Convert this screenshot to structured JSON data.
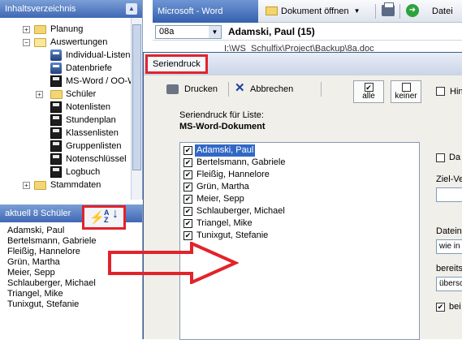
{
  "tree_panel": {
    "title": "Inhaltsverzeichnis",
    "items": [
      {
        "label": "Planung",
        "icon": "folder-icon",
        "expander": "+"
      },
      {
        "label": "Auswertungen",
        "icon": "folder-open-icon",
        "expander": "-"
      },
      {
        "label": "Individual-Listen",
        "icon": "printer-icon"
      },
      {
        "label": "Datenbriefe",
        "icon": "printer-icon"
      },
      {
        "label": "MS-Word / OO-W",
        "icon": "disk-icon"
      },
      {
        "label": "Schüler",
        "icon": "folder-icon",
        "expander": "+"
      },
      {
        "label": "Notenlisten",
        "icon": "disk-icon"
      },
      {
        "label": "Stundenplan",
        "icon": "disk-icon"
      },
      {
        "label": "Klassenlisten",
        "icon": "disk-icon"
      },
      {
        "label": "Gruppenlisten",
        "icon": "disk-icon"
      },
      {
        "label": "Notenschlüssel",
        "icon": "disk-icon"
      },
      {
        "label": "Logbuch",
        "icon": "disk-icon"
      },
      {
        "label": "Stammdaten",
        "icon": "folder-icon",
        "expander": "+"
      }
    ]
  },
  "student_panel": {
    "title": "aktuell 8 Schüler",
    "tools": {
      "bolt": "⚡",
      "sort_top": "A",
      "sort_bottom": "Z",
      "sort_arrow": "↓"
    },
    "students": [
      "Adamski, Paul",
      "Bertelsmann, Gabriele",
      "Fleißig, Hannelore",
      "Grün, Martha",
      "Meier, Sepp",
      "Schlauberger, Michael",
      "Triangel, Mike",
      "Tunixgut, Stefanie"
    ]
  },
  "toolbar": {
    "app_title": "Microsoft - Word",
    "open_label": "Dokument öffnen",
    "file_label": "Datei"
  },
  "class_row": {
    "class_value": "08a",
    "current_student": "Adamski, Paul  (15)",
    "path": "I:\\WS_Schulfix\\Project\\Backup\\8a.doc"
  },
  "dialog": {
    "title": "Seriendruck",
    "print_label": "Drucken",
    "cancel_label": "Abbrechen",
    "all_label": "alle",
    "none_label": "keiner",
    "hint_label": "Hin",
    "intro_line1": "Seriendruck für Liste:",
    "intro_line2": "MS-Word-Dokument",
    "list": [
      "Adamski, Paul",
      "Bertelsmann, Gabriele",
      "Fleißig, Hannelore",
      "Grün, Martha",
      "Meier, Sepp",
      "Schlauberger, Michael",
      "Triangel, Mike",
      "Tunixgut, Stefanie"
    ],
    "selected_index": 0,
    "right": {
      "checkbox1_label": "Da",
      "ziel_label": "Ziel-Ve",
      "dateiname_label": "Dateina",
      "dateiname_value": "wie in",
      "bereits_label": "bereits",
      "bereits_value": "übersc",
      "checkbox2_label": "bei"
    }
  },
  "colors": {
    "caption_blue": "#3f68b4",
    "selection_blue": "#3168c5",
    "annotation_red": "#e2232a"
  }
}
